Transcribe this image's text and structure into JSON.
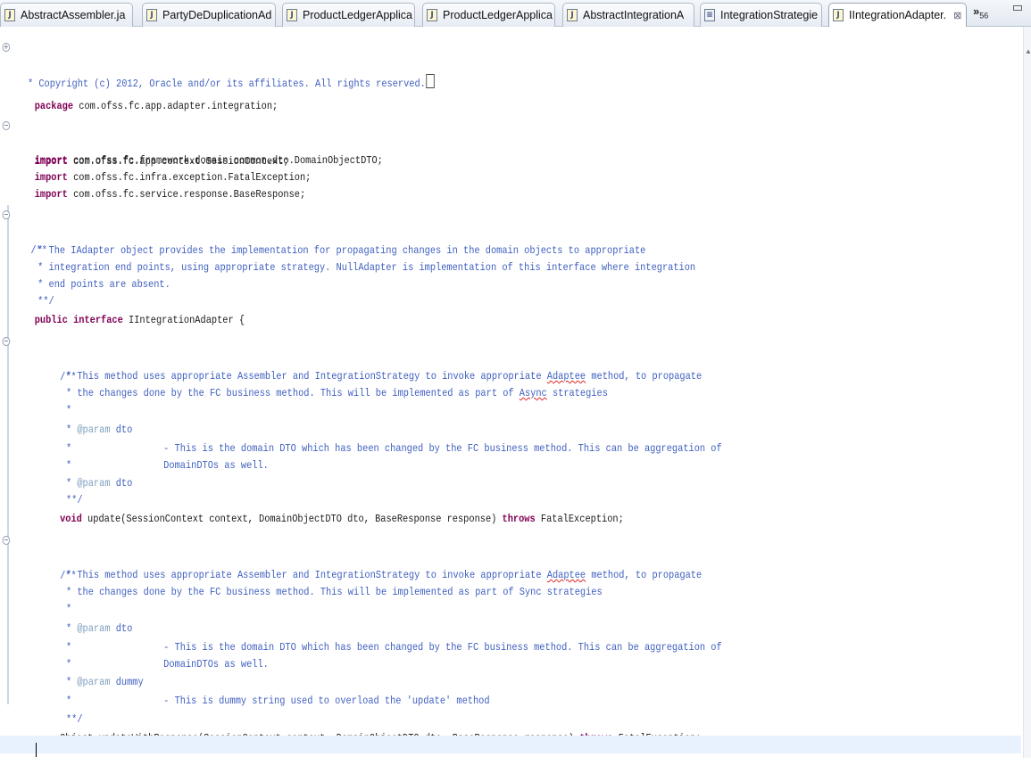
{
  "tabs": [
    {
      "label": "AbstractAssembler.ja",
      "icon": "java-file-icon"
    },
    {
      "label": "PartyDeDuplicationAd",
      "icon": "java-file-icon"
    },
    {
      "label": "ProductLedgerApplica",
      "icon": "java-file-icon"
    },
    {
      "label": "ProductLedgerApplica",
      "icon": "java-file-icon"
    },
    {
      "label": "AbstractIntegrationA",
      "icon": "java-file-icon"
    },
    {
      "label": "IntegrationStrategie",
      "icon": "file-icon"
    },
    {
      "label": "IIntegrationAdapter.",
      "icon": "java-file-icon",
      "active": true,
      "close": "⊠"
    }
  ],
  "overflow": {
    "chevron": "»",
    "count": "56"
  },
  "code": {
    "copyright": "* Copyright (c) 2012, Oracle and/or its affiliates. All rights reserved.",
    "package_kw": "package",
    "package_name": "com.ofss.fc.app.adapter.integration;",
    "import_kw": "import",
    "imports": [
      "com.ofss.fc.app.context.SessionContext;",
      "com.ofss.fc.framework.domain.common.dto.DomainObjectDTO;",
      "com.ofss.fc.infra.exception.FatalException;",
      "com.ofss.fc.service.response.BaseResponse;"
    ],
    "doc_open": "/**",
    "doc_lines": [
      "* The IAdapter object provides the implementation for propagating changes in the domain objects to appropriate",
      "* integration end points, using appropriate strategy. NullAdapter is implementation of this interface where integration",
      "* end points are absent."
    ],
    "doc_close": "**/",
    "public_kw": "public",
    "interface_kw": "interface",
    "interface_name": "IIntegrationAdapter {",
    "m1_line1_a": "* This method uses appropriate Assembler and IntegrationStrategy to invoke appropriate ",
    "m1_line1_sq": "Adaptee",
    "m1_line1_b": " method, to propagate",
    "m1_line2_a": "* the changes done by the FC business method. This will be implemented as part of ",
    "m1_line2_sq": "Async",
    "m1_line2_b": " strategies",
    "star": "*",
    "param_tag": "@param",
    "param_dto": "dto",
    "param_dummy": "dummy",
    "param_desc1": "- This is the domain DTO which has been changed by the FC business method. This can be aggregation of",
    "param_desc2": "DomainDTOs as well.",
    "m1_void_kw": "void",
    "m1_signature": "update(SessionContext context, DomainObjectDTO dto, BaseResponse response)",
    "throws_kw": "throws",
    "exception": "FatalException;",
    "m2_line1_a": "* This method uses appropriate Assembler and IntegrationStrategy to invoke appropriate ",
    "m2_line1_sq": "Adaptee",
    "m2_line1_b": " method, to propagate",
    "m2_line2": "* the changes done by the FC business method. This will be implemented as part of Sync strategies",
    "dummy_desc": "- This is dummy string used to overload the 'update' method",
    "m2_signature": "Object updateWithResponse(SessionContext context, DomainObjectDTO dto, BaseResponse response)"
  }
}
